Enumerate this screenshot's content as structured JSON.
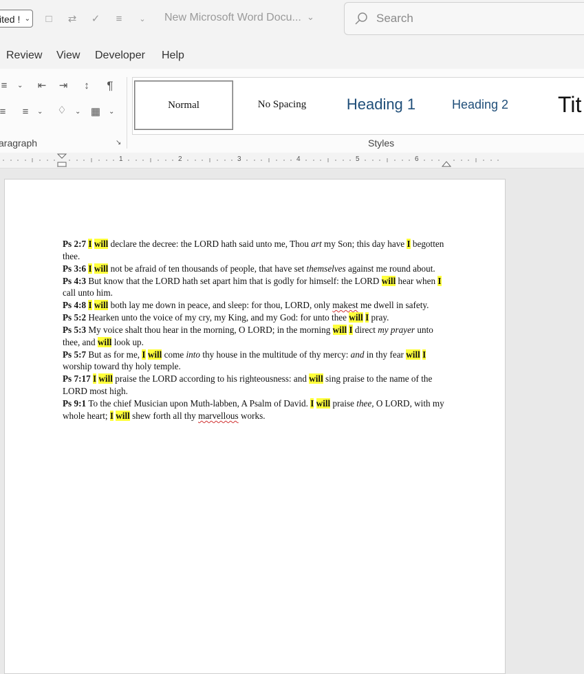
{
  "titlebar": {
    "font_box": "ited !",
    "doc_title": "New Microsoft Word Docu...",
    "search_placeholder": "Search"
  },
  "menu": [
    "Review",
    "View",
    "Developer",
    "Help"
  ],
  "ribbon": {
    "paragraph_label": "aragraph",
    "styles_label": "Styles",
    "styles": [
      "Normal",
      "No Spacing",
      "Heading 1",
      "Heading 2",
      "Tit"
    ]
  },
  "ruler": {
    "numbers": [
      "1",
      "2",
      "3",
      "4",
      "5",
      "6"
    ]
  },
  "document": {
    "verses": [
      [
        {
          "t": "Ps 2:7 ",
          "s": "ref"
        },
        {
          "t": "I",
          "s": "hl"
        },
        {
          "t": " "
        },
        {
          "t": "will",
          "s": "hl"
        },
        {
          "t": " declare the decree: the LORD hath said unto me, Thou "
        },
        {
          "t": "art",
          "s": "em"
        },
        {
          "t": " my Son; this day have "
        },
        {
          "t": "I",
          "s": "hl"
        },
        {
          "t": " begotten thee."
        }
      ],
      [
        {
          "t": "Ps 3:6 ",
          "s": "ref"
        },
        {
          "t": "I",
          "s": "hl"
        },
        {
          "t": " "
        },
        {
          "t": "will",
          "s": "hl"
        },
        {
          "t": " not be afraid of ten thousands of people, that have set "
        },
        {
          "t": "themselves",
          "s": "em"
        },
        {
          "t": " against me round about."
        }
      ],
      [
        {
          "t": "Ps 4:3 ",
          "s": "ref"
        },
        {
          "t": "But know that the LORD hath set apart him that is godly for himself: the LORD "
        },
        {
          "t": "will",
          "s": "hl"
        },
        {
          "t": " hear when "
        },
        {
          "t": "I",
          "s": "hl"
        },
        {
          "t": " call unto him."
        }
      ],
      [
        {
          "t": "Ps 4:8 ",
          "s": "ref"
        },
        {
          "t": "I",
          "s": "hl"
        },
        {
          "t": " "
        },
        {
          "t": "will",
          "s": "hl"
        },
        {
          "t": " both lay me down in peace, and sleep: for thou, LORD, only "
        },
        {
          "t": "makest",
          "s": "sq"
        },
        {
          "t": " me dwell in safety."
        }
      ],
      [
        {
          "t": "Ps 5:2 ",
          "s": "ref"
        },
        {
          "t": "Hearken unto the voice of my cry, my King, and my God: for unto thee "
        },
        {
          "t": "will",
          "s": "hl"
        },
        {
          "t": " "
        },
        {
          "t": "I",
          "s": "hl"
        },
        {
          "t": " pray."
        }
      ],
      [
        {
          "t": "Ps 5:3 ",
          "s": "ref"
        },
        {
          "t": "My voice shalt thou hear in the morning, O LORD; in the morning "
        },
        {
          "t": "will",
          "s": "hl"
        },
        {
          "t": " "
        },
        {
          "t": "I",
          "s": "hl"
        },
        {
          "t": " direct "
        },
        {
          "t": "my prayer",
          "s": "em"
        },
        {
          "t": " unto thee, and "
        },
        {
          "t": "will",
          "s": "hl"
        },
        {
          "t": " look up."
        }
      ],
      [
        {
          "t": "Ps 5:7 ",
          "s": "ref"
        },
        {
          "t": "But as for me, "
        },
        {
          "t": "I",
          "s": "hl"
        },
        {
          "t": " "
        },
        {
          "t": "will",
          "s": "hl"
        },
        {
          "t": " come "
        },
        {
          "t": "into",
          "s": "em"
        },
        {
          "t": " thy house in the multitude of thy mercy: "
        },
        {
          "t": "and",
          "s": "em"
        },
        {
          "t": " in thy fear "
        },
        {
          "t": "will",
          "s": "hl"
        },
        {
          "t": " "
        },
        {
          "t": "I",
          "s": "hl"
        },
        {
          "t": " worship toward thy holy temple."
        }
      ],
      [
        {
          "t": "Ps 7:17 ",
          "s": "ref"
        },
        {
          "t": "I",
          "s": "hl"
        },
        {
          "t": " "
        },
        {
          "t": "will",
          "s": "hl"
        },
        {
          "t": " praise the LORD according to his righteousness: and "
        },
        {
          "t": "will",
          "s": "hl"
        },
        {
          "t": " sing praise to the name of the LORD most high."
        }
      ],
      [
        {
          "t": "Ps 9:1 ",
          "s": "ref"
        },
        {
          "t": "To the chief Musician upon Muth-labben, A Psalm of David. "
        },
        {
          "t": "I",
          "s": "hl"
        },
        {
          "t": " "
        },
        {
          "t": "will",
          "s": "hl"
        },
        {
          "t": " praise "
        },
        {
          "t": "thee,",
          "s": "em"
        },
        {
          "t": " O LORD, with my whole heart; "
        },
        {
          "t": "I",
          "s": "hl"
        },
        {
          "t": " "
        },
        {
          "t": "will",
          "s": "hl"
        },
        {
          "t": " shew forth all thy "
        },
        {
          "t": "marvellous",
          "s": "sq"
        },
        {
          "t": " works."
        }
      ]
    ]
  }
}
